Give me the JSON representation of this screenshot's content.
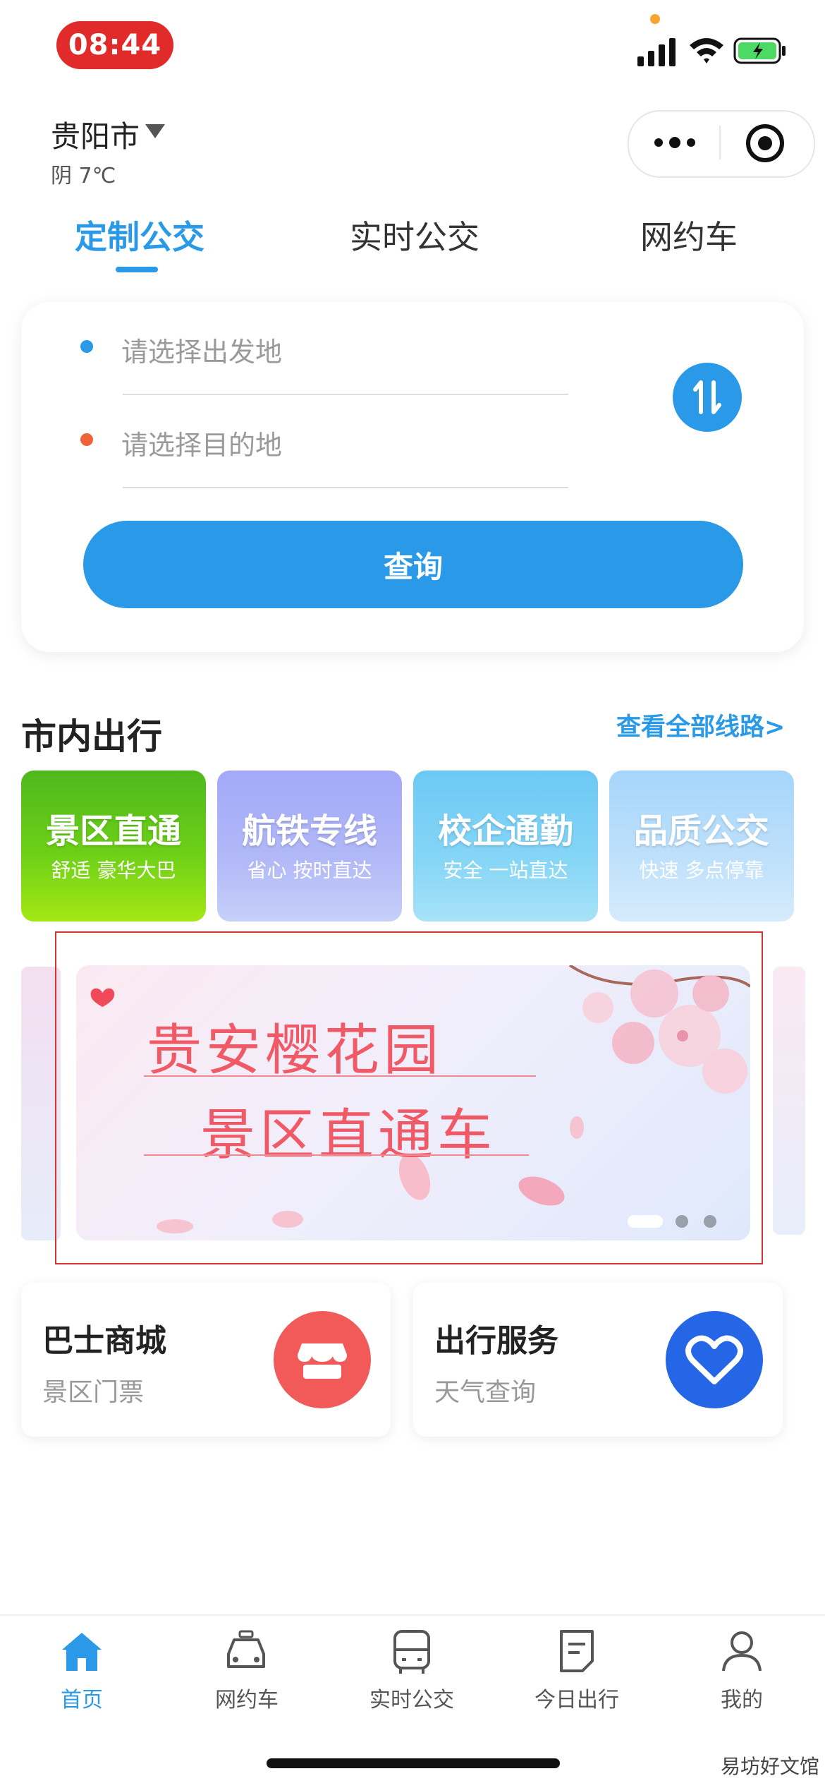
{
  "status_bar": {
    "time": "08:44"
  },
  "header": {
    "city": "贵阳市",
    "weather": "阴 7℃"
  },
  "tabs": [
    {
      "label": "定制公交",
      "active": true
    },
    {
      "label": "实时公交",
      "active": false
    },
    {
      "label": "网约车",
      "active": false
    }
  ],
  "search": {
    "from_placeholder": "请选择出发地",
    "to_placeholder": "请选择目的地",
    "query_label": "查询"
  },
  "section": {
    "title": "市内出行",
    "view_all": "查看全部线路>"
  },
  "tiles": [
    {
      "title": "景区直通",
      "subtitle": "舒适  豪华大巴",
      "color": "#62c61d"
    },
    {
      "title": "航铁专线",
      "subtitle": "省心  按时直达",
      "color": "#a6aef8"
    },
    {
      "title": "校企通勤",
      "subtitle": "安全  一站直达",
      "color": "#7ed0f5"
    },
    {
      "title": "品质公交",
      "subtitle": "快速  多点停靠",
      "color": "#b4dcfb"
    }
  ],
  "banner": {
    "line1": "贵安樱花园",
    "line2": "景区直通车"
  },
  "services": [
    {
      "title": "巴士商城",
      "subtitle": "景区门票",
      "icon": "shop-icon",
      "color": "#f25a5a"
    },
    {
      "title": "出行服务",
      "subtitle": "天气查询",
      "icon": "heart-icon",
      "color": "#2466e6"
    }
  ],
  "bottom_nav": [
    {
      "label": "首页",
      "icon": "home-icon",
      "active": true
    },
    {
      "label": "网约车",
      "icon": "taxi-icon",
      "active": false
    },
    {
      "label": "实时公交",
      "icon": "bus-icon",
      "active": false
    },
    {
      "label": "今日出行",
      "icon": "note-icon",
      "active": false
    },
    {
      "label": "我的",
      "icon": "user-icon",
      "active": false
    }
  ],
  "watermark": "易坊好文馆",
  "colors": {
    "accent": "#2a9ae8",
    "from_dot": "#2a9ae8",
    "to_dot": "#f0633a"
  }
}
